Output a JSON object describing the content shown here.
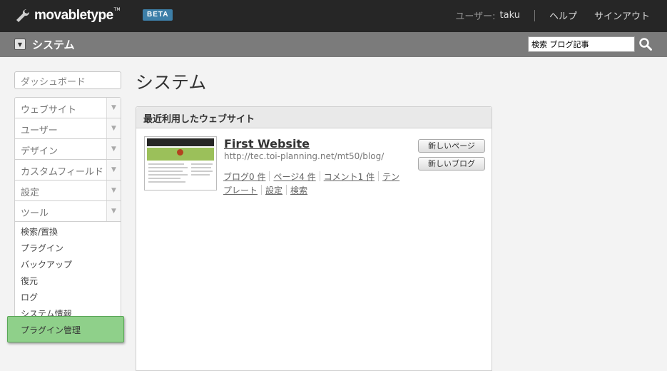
{
  "header": {
    "logo_text": "movabletype",
    "logo_tm": "TM",
    "beta_label": "BETA",
    "user_label": "ユーザー:",
    "user_name": "taku",
    "help_label": "ヘルプ",
    "signout_label": "サインアウト"
  },
  "subheader": {
    "scope_title": "システム",
    "search_value": "検索 ブログ記事"
  },
  "sidebar": {
    "dashboard_label": "ダッシュボード",
    "menus": [
      {
        "label": "ウェブサイト"
      },
      {
        "label": "ユーザー"
      },
      {
        "label": "デザイン"
      },
      {
        "label": "カスタムフィールド"
      },
      {
        "label": "設定"
      },
      {
        "label": "ツール"
      }
    ],
    "tools_submenu": [
      {
        "label": "検索/置換"
      },
      {
        "label": "プラグイン"
      },
      {
        "label": "バックアップ"
      },
      {
        "label": "復元"
      },
      {
        "label": "ログ"
      },
      {
        "label": "システム情報"
      }
    ],
    "highlighted_item": "プラグイン管理"
  },
  "main": {
    "page_title": "システム",
    "widget": {
      "title": "最近利用したウェブサイト",
      "site_name": "First Website",
      "site_url": "http://tec.toi-planning.net/mt50/blog/",
      "links": {
        "blogs": "ブログ0 件",
        "pages": "ページ4 件",
        "comments": "コメント1 件",
        "templates": "テンプレート",
        "settings": "設定",
        "search": "検索"
      },
      "new_page_button": "新しいページ",
      "new_blog_button": "新しいブログ"
    }
  },
  "colors": {
    "topbar": "#262626",
    "subbar": "#7b7b7b",
    "beta": "#3d7fa8",
    "highlight": "#8fd08a"
  }
}
